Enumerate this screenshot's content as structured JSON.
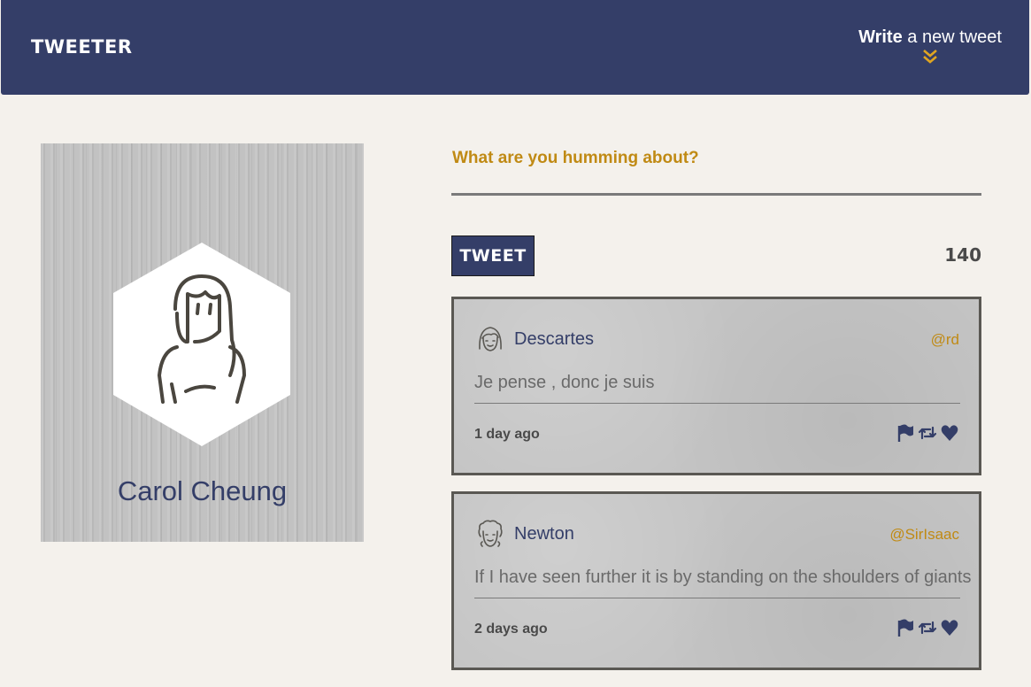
{
  "nav": {
    "brand": "TWEETER",
    "compose_strong": "Write",
    "compose_rest": " a new tweet"
  },
  "profile": {
    "name": "Carol Cheung"
  },
  "composer": {
    "prompt": "What are you humming about?",
    "button_label": "TWEET",
    "counter": "140"
  },
  "tweets": [
    {
      "name": "Descartes",
      "handle": "@rd",
      "text": "Je pense , donc je suis",
      "time": "1 day ago"
    },
    {
      "name": "Newton",
      "handle": "@SirIsaac",
      "text": "If I have seen further it is by standing on the shoulders of giants",
      "time": "2 days ago"
    }
  ],
  "colors": {
    "navy": "#343e68",
    "gold": "#c08a14",
    "page": "#f4f1ec"
  }
}
